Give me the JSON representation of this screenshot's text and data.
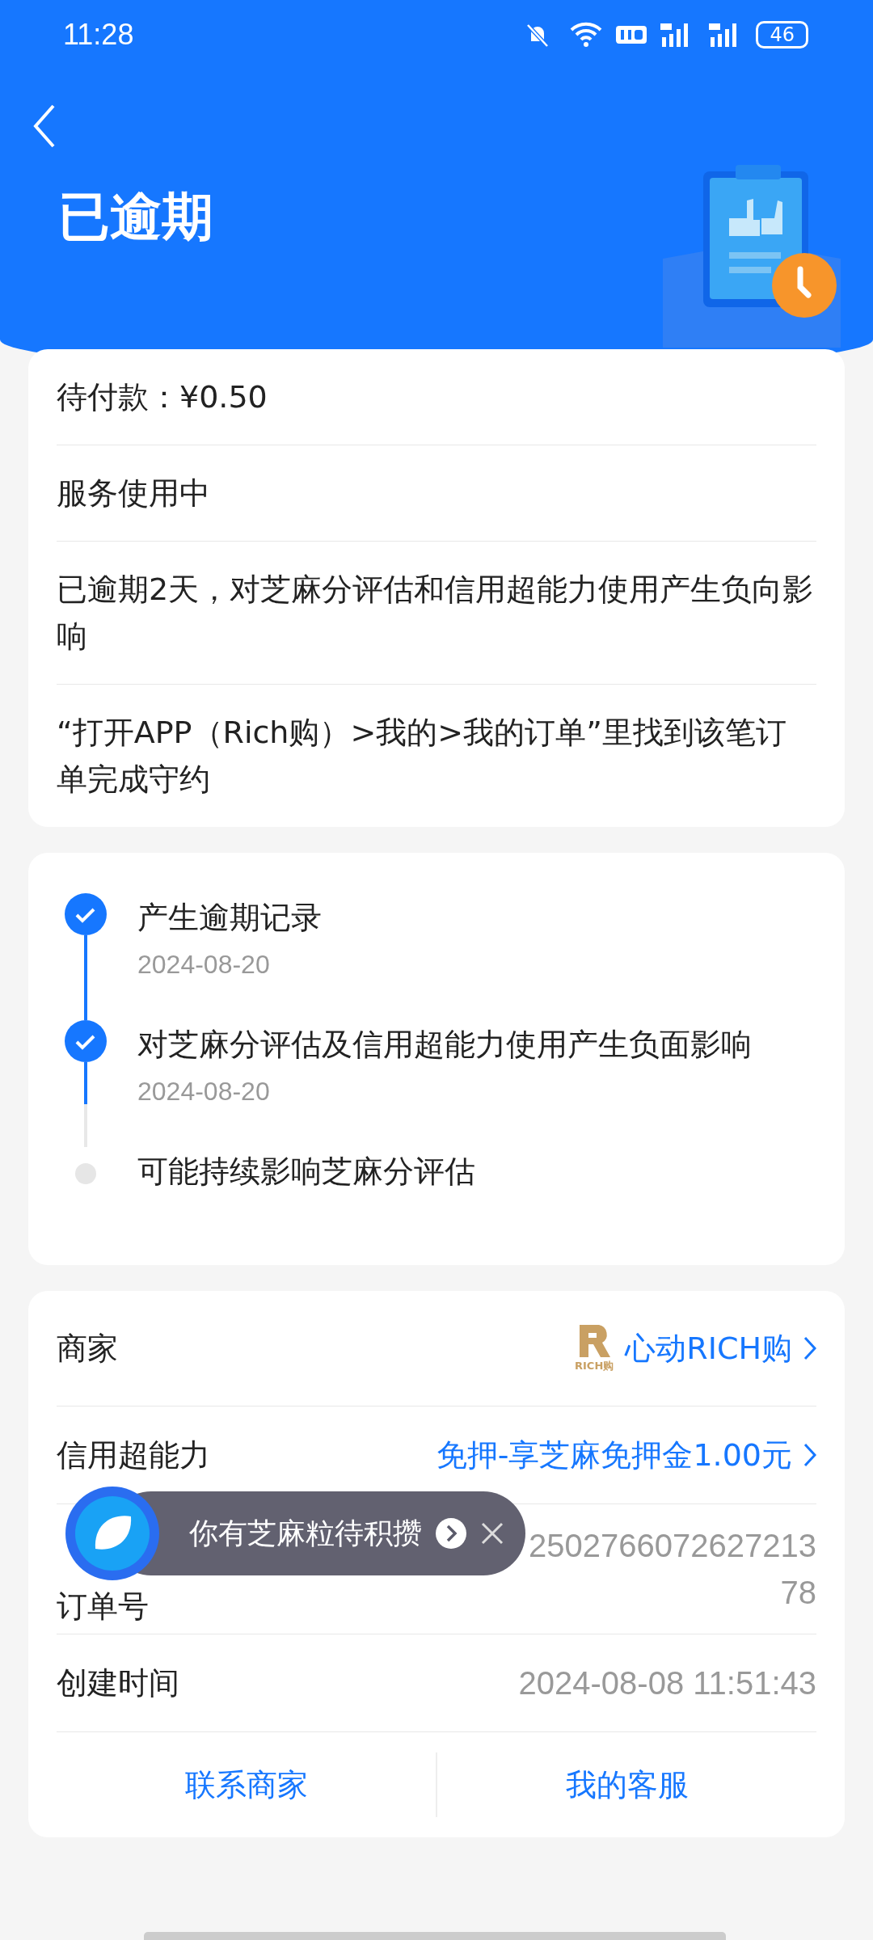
{
  "status_bar": {
    "time": "11:28",
    "battery": "46"
  },
  "header": {
    "title": "已逾期"
  },
  "summary": {
    "rows": [
      {
        "text": "待付款：¥0.50"
      },
      {
        "text": "服务使用中"
      },
      {
        "text": "已逾期2天，对芝麻分评估和信用超能力使用产生负向影响"
      },
      {
        "text": "“打开APP（Rich购）>我的>我的订单”里找到该笔订单完成守约"
      }
    ]
  },
  "timeline": [
    {
      "title": "产生逾期记录",
      "date": "2024-08-20",
      "done": true
    },
    {
      "title": "对芝麻分评估及信用超能力使用产生负面影响",
      "date": "2024-08-20",
      "done": true
    },
    {
      "title": "可能持续影响芝麻分评估",
      "done": false
    }
  ],
  "details": {
    "merchant": {
      "label": "商家",
      "logo_text": "RICH购",
      "value": "心动RICH购"
    },
    "credit": {
      "label": "信用超能力",
      "value": "免押-享芝麻免押金1.00元"
    },
    "order": {
      "label": "订单号",
      "value_lines": [
        "2502766072627213",
        "78"
      ]
    },
    "created": {
      "label": "创建时间",
      "value": "2024-08-08 11:51:43"
    },
    "buttons": [
      "联系商家",
      "我的客服"
    ]
  },
  "toast": {
    "text": "你有芝麻粒待积攒"
  }
}
